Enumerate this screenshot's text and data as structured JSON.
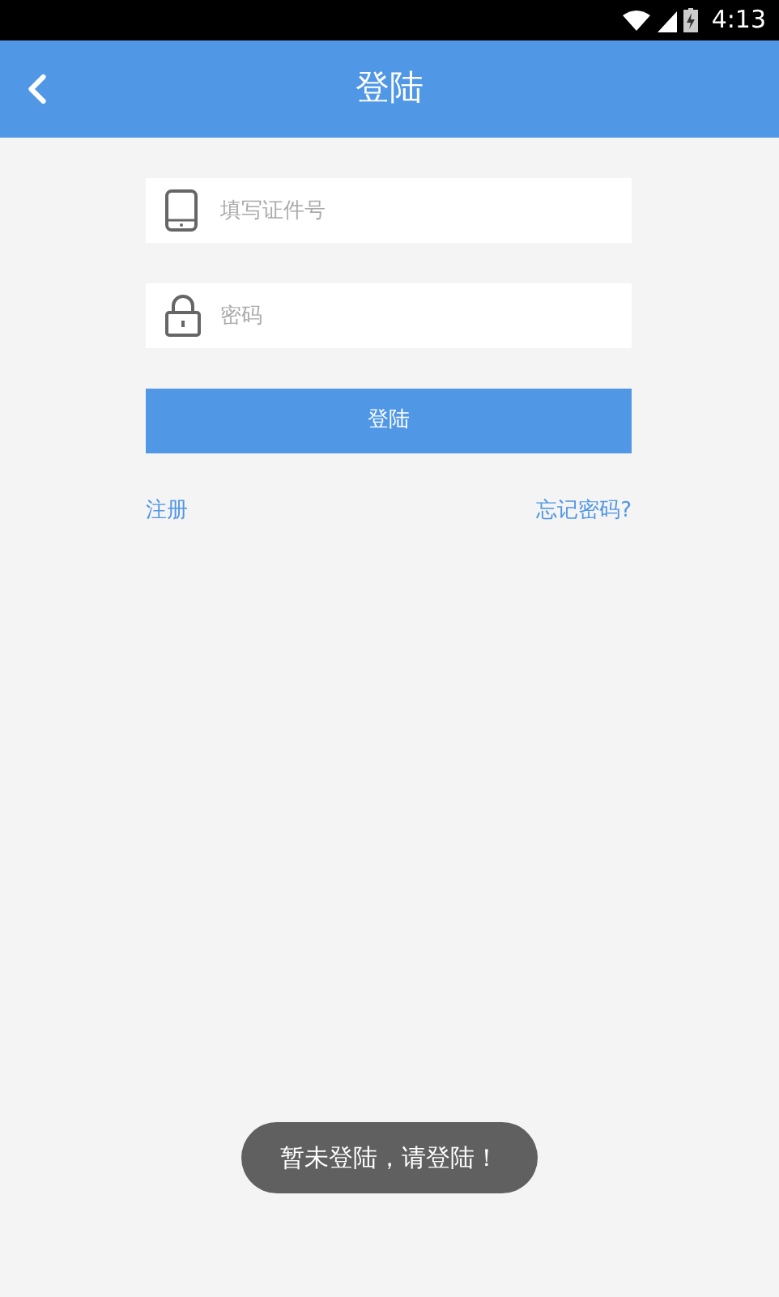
{
  "status_bar": {
    "time": "4:13"
  },
  "header": {
    "title": "登陆"
  },
  "form": {
    "id_field": {
      "placeholder": "填写证件号"
    },
    "password_field": {
      "placeholder": "密码"
    },
    "login_button": "登陆",
    "register_link": "注册",
    "forgot_link": "忘记密码?"
  },
  "toast": "暂未登陆，请登陆！"
}
